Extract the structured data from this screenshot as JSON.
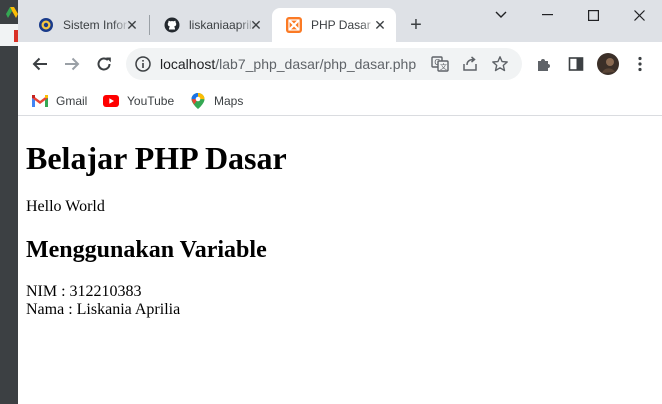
{
  "tabs": [
    {
      "title": "Sistem Informasi",
      "favicon": "university-seal-icon",
      "active": false
    },
    {
      "title": "liskaniaaprilia",
      "favicon": "github-icon",
      "active": false
    },
    {
      "title": "PHP Dasar",
      "favicon": "xampp-icon",
      "active": true
    }
  ],
  "toolbar": {
    "url_host": "localhost",
    "url_path": "/lab7_php_dasar/php_dasar.php"
  },
  "bookmarks": [
    {
      "label": "Gmail",
      "icon": "gmail-icon"
    },
    {
      "label": "YouTube",
      "icon": "youtube-icon"
    },
    {
      "label": "Maps",
      "icon": "maps-icon"
    }
  ],
  "page": {
    "heading": "Belajar PHP Dasar",
    "hello": "Hello World",
    "subheading": "Menggunakan Variable",
    "nim_line": "NIM : 312210383",
    "nama_line": "Nama : Liskania Aprilia"
  },
  "colors": {
    "tabstrip_bg": "#dee1e6",
    "omnibox_bg": "#f1f3f4",
    "xampp_orange": "#fb7a24",
    "youtube_red": "#ff0000"
  }
}
